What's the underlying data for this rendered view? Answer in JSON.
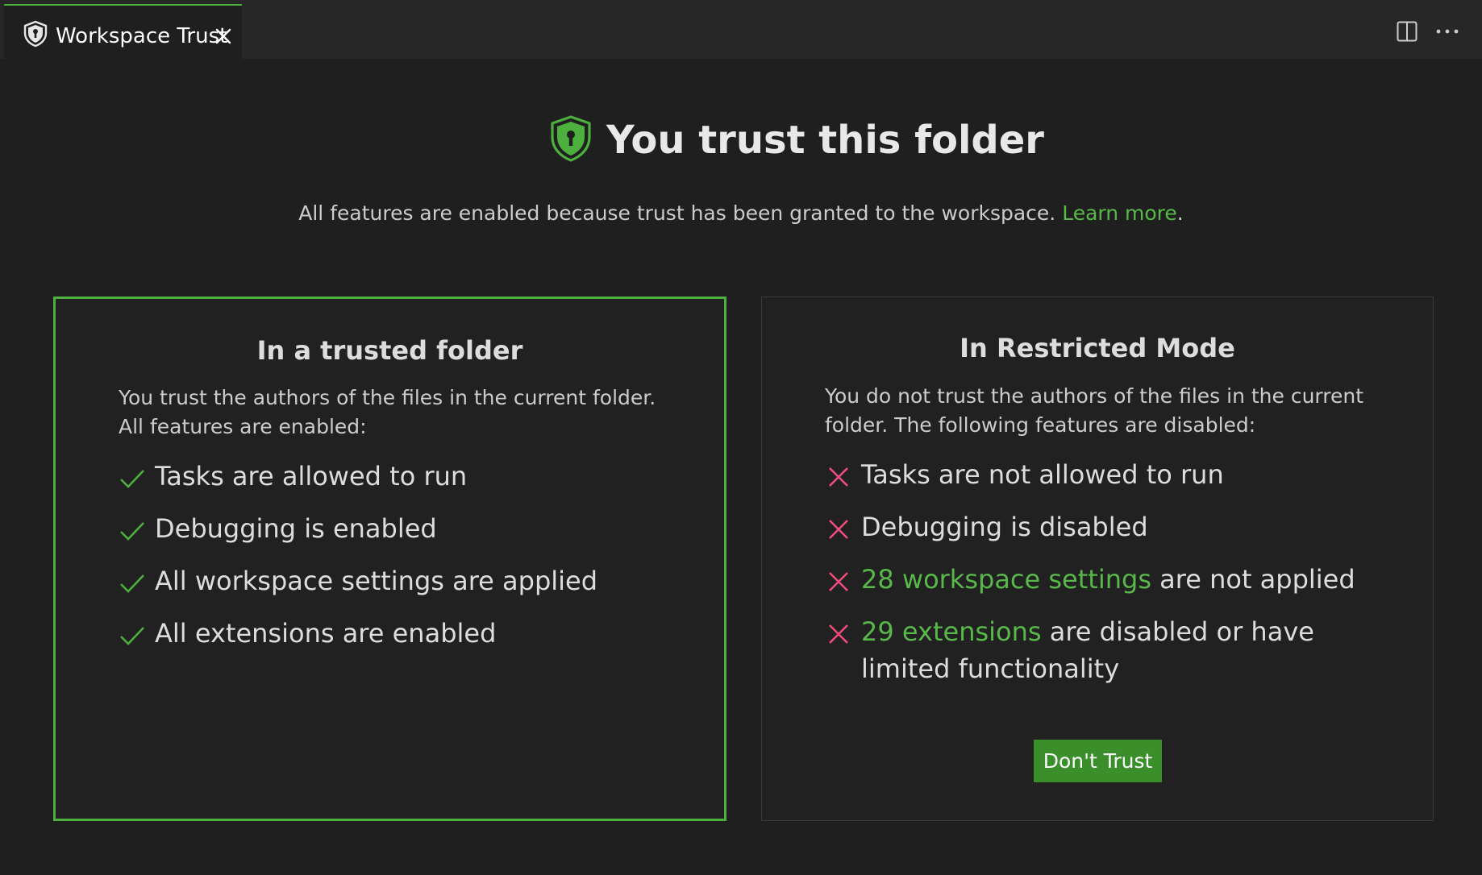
{
  "tab": {
    "title": "Workspace Trust",
    "icon": "shield-icon",
    "close_icon": "close-icon"
  },
  "editor_actions": {
    "split_icon": "split-editor-icon",
    "more_icon": "more-actions-icon"
  },
  "header": {
    "title": "You trust this folder",
    "icon": "shield-icon",
    "subtitle_text": "All features are enabled because trust has been granted to the workspace.",
    "learn_more": "Learn more",
    "subtitle_end": "."
  },
  "trusted_card": {
    "title": "In a trusted folder",
    "description": "You trust the authors of the files in the current folder. All features are enabled:",
    "features": [
      {
        "icon": "check-icon",
        "text": "Tasks are allowed to run"
      },
      {
        "icon": "check-icon",
        "text": "Debugging is enabled"
      },
      {
        "icon": "check-icon",
        "text": "All workspace settings are applied"
      },
      {
        "icon": "check-icon",
        "text": "All extensions are enabled"
      }
    ]
  },
  "restricted_card": {
    "title": "In Restricted Mode",
    "description": "You do not trust the authors of the files in the current folder. The following features are disabled:",
    "features": [
      {
        "icon": "x-icon",
        "link": "",
        "text": "Tasks are not allowed to run"
      },
      {
        "icon": "x-icon",
        "link": "",
        "text": "Debugging is disabled"
      },
      {
        "icon": "x-icon",
        "link": "28 workspace settings",
        "text": " are not applied"
      },
      {
        "icon": "x-icon",
        "link": "29 extensions",
        "text": " are disabled or have limited functionality"
      }
    ],
    "button_label": "Don't Trust"
  },
  "colors": {
    "accent_green": "#4caf3e",
    "link_green": "#59b84a",
    "error_red": "#f14c7c",
    "button_bg": "#3a8f2a"
  }
}
